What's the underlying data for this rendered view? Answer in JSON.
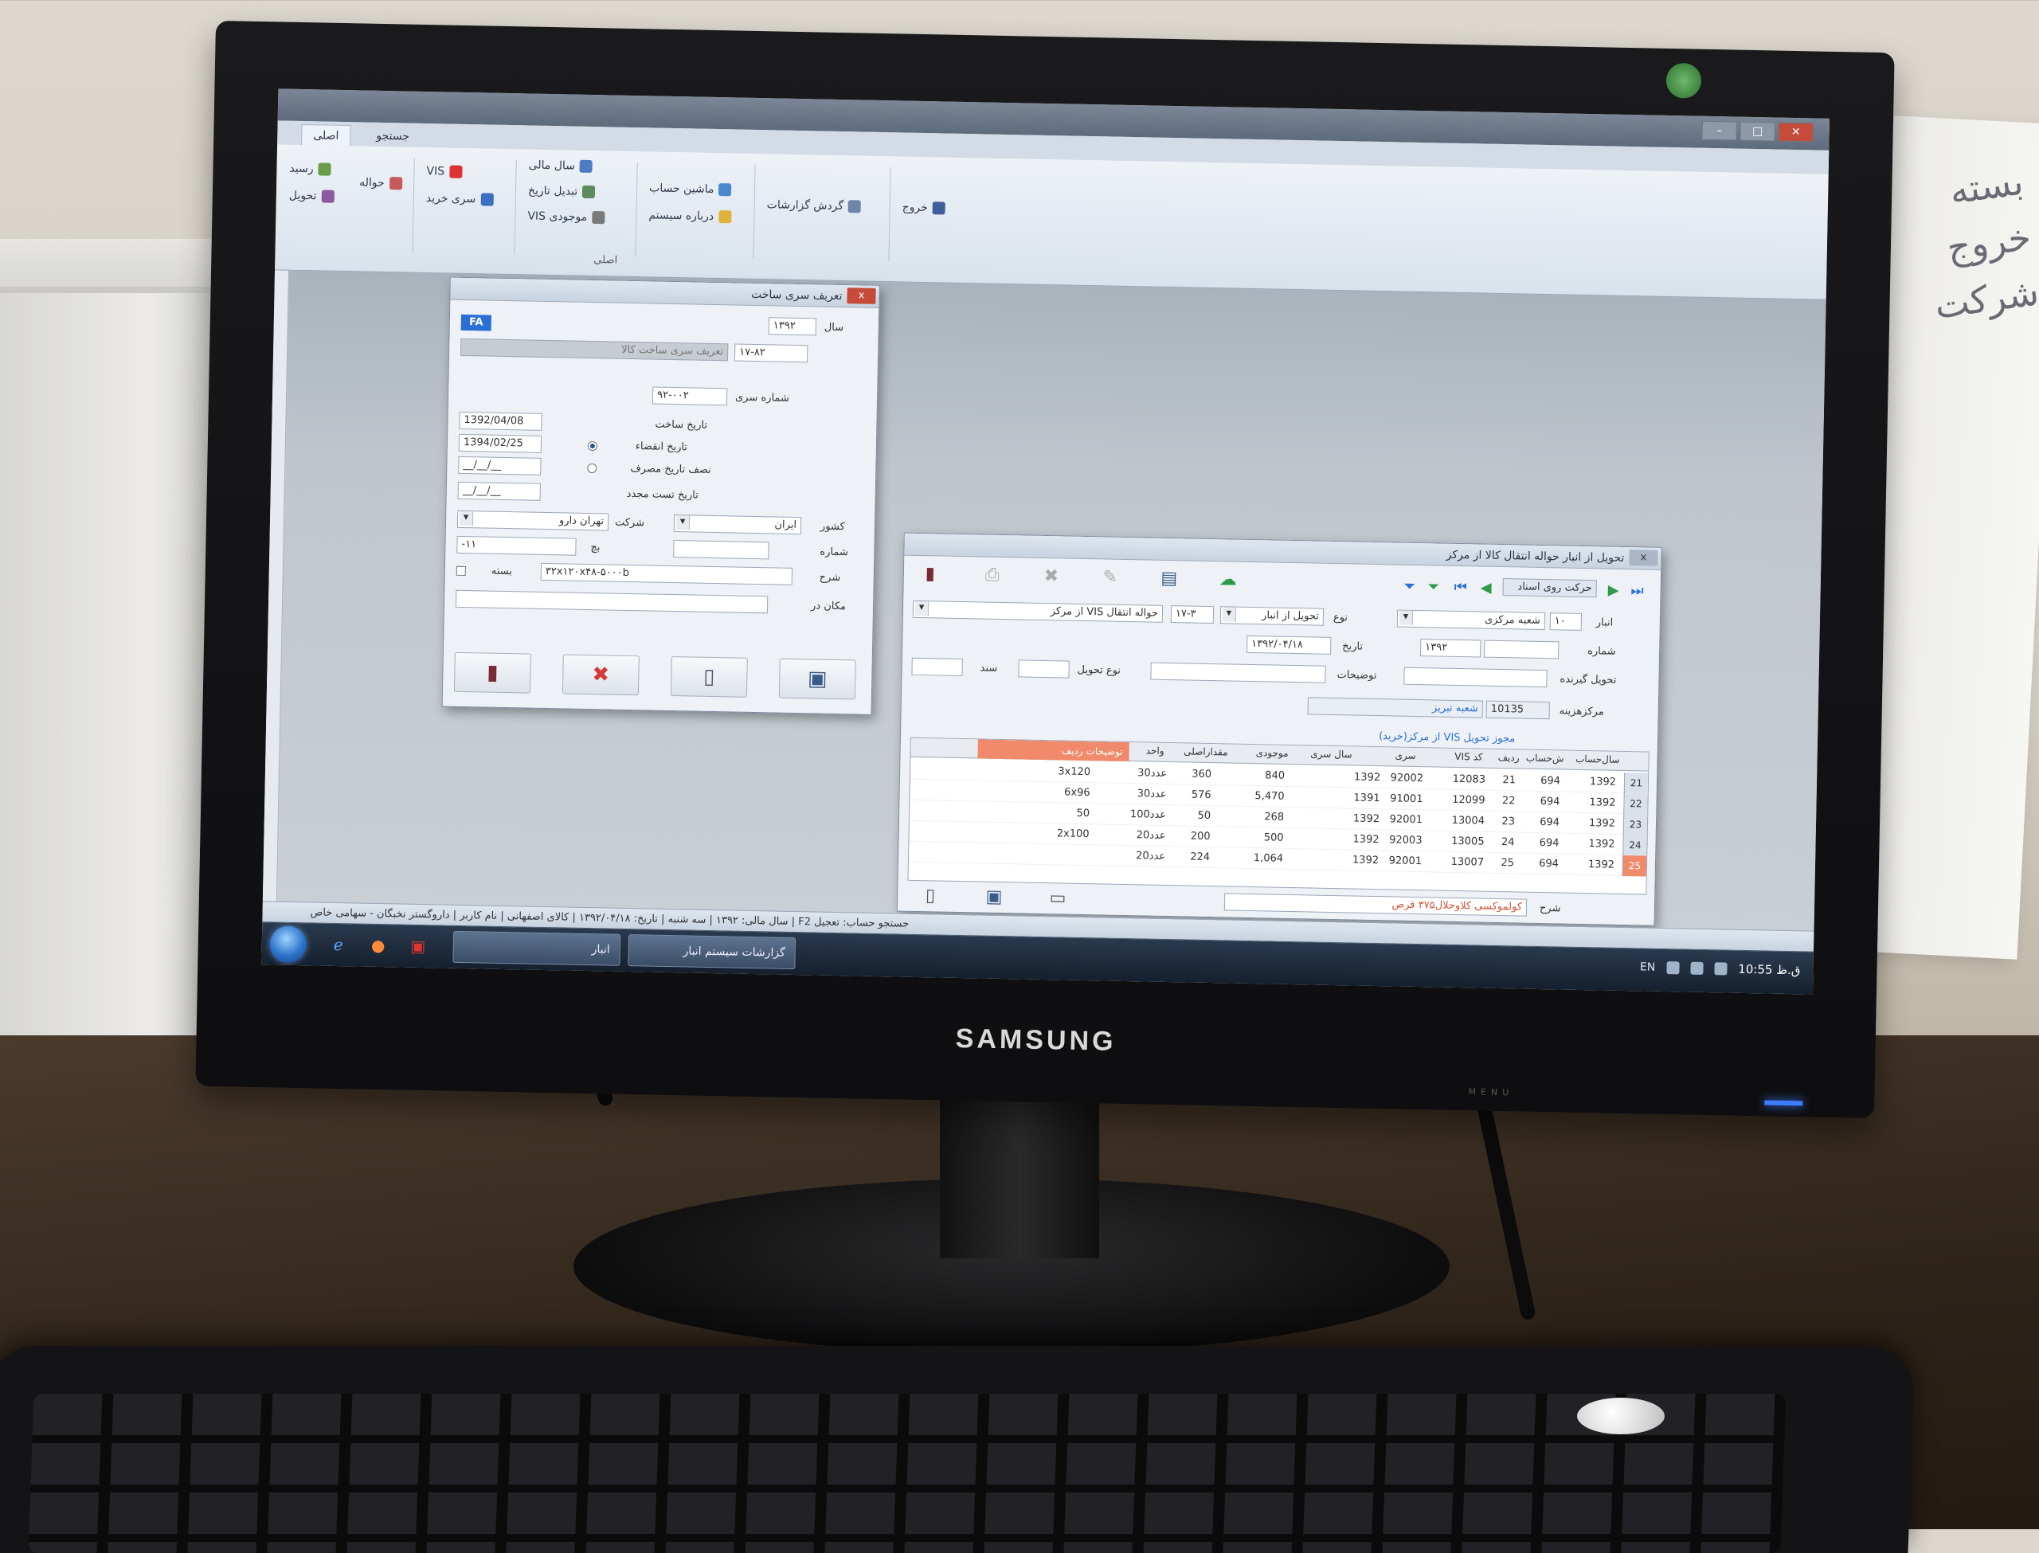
{
  "monitor": {
    "brand": "SAMSUNG",
    "bezel_buttons": "MENU"
  },
  "sticky_note": {
    "text": "بسته خروج شرکت"
  },
  "app": {
    "window_controls": {
      "minimize": "–",
      "maximize": "□",
      "close": "✕"
    },
    "ribbon_tabs": [
      "اصلی",
      "جستجو"
    ],
    "ribbon": {
      "group_label": "اصلی",
      "items": {
        "resid": "رسید",
        "tahvil": "تحویل",
        "havaleh": "حواله",
        "vis": "VIS",
        "seri_kharid": "سری خرید",
        "sal_mali": "سال مالی",
        "tabdil_tarikh": "تبدیل تاریخ",
        "mojoodi_vis": "موجودی VIS",
        "mashin_hesab": "ماشین حساب",
        "darbare": "درباره سیستم",
        "gardesh": "گردش گزارشات",
        "khorooj": "خروج"
      }
    },
    "dialog_series": {
      "title": "تعریف سری ساخت",
      "close_label": "x",
      "lang_badge": "FA",
      "year_label": "سال",
      "year_value": "۱۳۹۲",
      "code_value": "۱۷-۸۲",
      "desc_value": "تعریف سری ساخت کالا",
      "series_no_label": "شماره سری",
      "series_no_value": "۹۲-۰۰۲",
      "build_date_label": "تاریخ ساخت",
      "build_date_value": "1392/04/08",
      "expire_label": "تاریخ انقضاء",
      "expire_value": "1394/02/25",
      "half_label": "نصف تاریخ مصرف",
      "half_value": "__/__/__",
      "test_label": "تاریخ تست مجدد",
      "test_value": "__/__/__",
      "country_label": "کشور",
      "country_value": "ایران",
      "company_label": "شرکت",
      "company_value": "تهران دارو",
      "number_label": "شماره",
      "number_value": "",
      "batch_label": "بچ",
      "batch_value": "-۱۱",
      "desc_label": "شرح",
      "desc_field": "۳۲x۱۲۰x۴۸-۵۰۰۰b",
      "pack_label": "بسته",
      "place_label": "مکان در",
      "place_value": "",
      "buttons": {
        "save": "▮",
        "delete": "✖",
        "new": "▯",
        "exit": "▣"
      }
    },
    "dialog_transfer": {
      "title": "تحویل از انبار حواله انتقال کالا از مرکز",
      "toolbar_label": "حرکت روی اسناد",
      "from_label": "انبار",
      "from_value": "۱۰",
      "branch_value": "شعبه مرکزی",
      "type_label": "نوع",
      "type_value": "تحویل از انبار",
      "code_value": "۱۷-۳",
      "doc_type_value": "حواله انتقال VIS از مرکز",
      "number_label": "شماره",
      "number_value": "۱۳۹۲",
      "date_label": "تاریخ",
      "date_value": "۱۳۹۲/۰۴/۱۸",
      "receiver_label": "تحویل گیرنده",
      "receiver_value": "",
      "notes_label": "توضیحات",
      "notes_value": "",
      "delivery_label": "نوع تحویل",
      "doc_label": "سند",
      "cost_center_label": "مرکزهزینه",
      "cost_center_code": "10135",
      "cost_center_value": "شعبه تبریز",
      "grid_caption": "مجوز تحویل VIS از مرکز(خرید)",
      "columns": [
        "سال‌حساب",
        "ش‌حساب",
        "ردیف",
        "کد VIS",
        "سری",
        "سال سری",
        "موجودی",
        "مقدار‌اصلی",
        "واحد",
        "توضیحات ردیف"
      ],
      "rows": [
        {
          "no": "21",
          "year": "1392",
          "acc": "694",
          "row": "21",
          "vis": "12083",
          "series": "92002",
          "syear": "1392",
          "stock": "840",
          "qty": "360",
          "unit": "30عدد",
          "desc": "3x120"
        },
        {
          "no": "22",
          "year": "1392",
          "acc": "694",
          "row": "22",
          "vis": "12099",
          "series": "91001",
          "syear": "1391",
          "stock": "5,470",
          "qty": "576",
          "unit": "30عدد",
          "desc": "6x96"
        },
        {
          "no": "23",
          "year": "1392",
          "acc": "694",
          "row": "23",
          "vis": "13004",
          "series": "92001",
          "syear": "1392",
          "stock": "268",
          "qty": "50",
          "unit": "100عدد",
          "desc": "50"
        },
        {
          "no": "24",
          "year": "1392",
          "acc": "694",
          "row": "24",
          "vis": "13005",
          "series": "92003",
          "syear": "1392",
          "stock": "500",
          "qty": "200",
          "unit": "20عدد",
          "desc": "2x100"
        },
        {
          "no": "25",
          "year": "1392",
          "acc": "694",
          "row": "25",
          "vis": "13007",
          "series": "92001",
          "syear": "1392",
          "stock": "1,064",
          "qty": "224",
          "unit": "20عدد",
          "desc": ""
        }
      ],
      "footer_desc_label": "شرح",
      "footer_desc_value": "کولموکسی کلاوحلال۳۷۵ قرص"
    },
    "status_bar": "جستجو حساب: تعجیل F2 | سال مالی: ۱۳۹۲ | سه شنبه | تاریخ: ۱۳۹۲/۰۴/۱۸ | کالای اصفهانی | نام کاربر | داروگستر نخبگان - سهامی خاص",
    "taskbar": {
      "task_1": "انبار",
      "task_2": "گزارشات سیستم انبار",
      "lang": "EN",
      "clock": "10:55 ق.ظ"
    }
  }
}
